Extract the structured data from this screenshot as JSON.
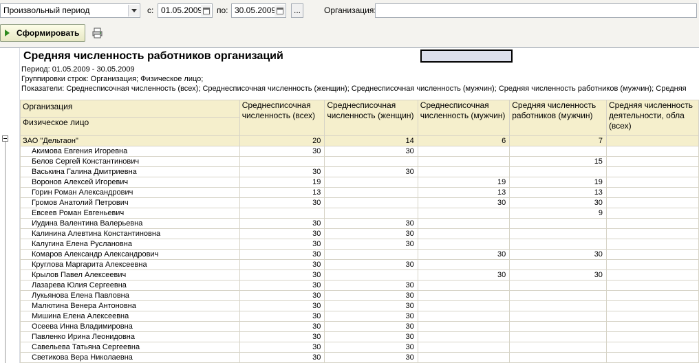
{
  "toolbar": {
    "period_type": "Произвольный период",
    "from_label": "с:",
    "from_date": "01.05.2009",
    "to_label": "по:",
    "to_date": "30.05.2009",
    "more_label": "...",
    "org_label": "Организация:",
    "org_value": "",
    "generate_label": "Сформировать"
  },
  "report": {
    "title": "Средняя численность работников организаций",
    "period": "Период: 01.05.2009 - 30.05.2009",
    "grouping": "Группировки строк: Организация; Физическое лицо;",
    "indicators": "Показатели: Среднесписочная численность (всех); Среднесписочная численность (женщин); Среднесписочная численность (мужчин); Средняя численность работников (мужчин); Средняя",
    "header_org": "Организация",
    "header_person": "Физическое лицо",
    "col1": "Среднесписочная численность (всех)",
    "col2": "Среднесписочная численность (женщин)",
    "col3": "Среднесписочная численность (мужчин)",
    "col4": "Средняя численность работников (мужчин)",
    "col5": "Средняя численность деятельности, обла (всех)",
    "group": {
      "name": "ЗАО \"Дельтаон\"",
      "c1": "20",
      "c2": "14",
      "c3": "6",
      "c4": "7"
    },
    "rows": [
      {
        "name": "Акимова Евгения Игоревна",
        "c1": "30",
        "c2": "30",
        "c3": "",
        "c4": ""
      },
      {
        "name": "Белов Сергей Константинович",
        "c1": "",
        "c2": "",
        "c3": "",
        "c4": "15"
      },
      {
        "name": "Васькина Галина Дмитриевна",
        "c1": "30",
        "c2": "30",
        "c3": "",
        "c4": ""
      },
      {
        "name": "Воронов Алексей Игоревич",
        "c1": "19",
        "c2": "",
        "c3": "19",
        "c4": "19"
      },
      {
        "name": "Горин Роман Александрович",
        "c1": "13",
        "c2": "",
        "c3": "13",
        "c4": "13"
      },
      {
        "name": "Громов Анатолий Петрович",
        "c1": "30",
        "c2": "",
        "c3": "30",
        "c4": "30"
      },
      {
        "name": "Евсеев Роман Евгеньевич",
        "c1": "",
        "c2": "",
        "c3": "",
        "c4": "9"
      },
      {
        "name": "Иудина Валентина Валерьевна",
        "c1": "30",
        "c2": "30",
        "c3": "",
        "c4": ""
      },
      {
        "name": "Калинина Алевтина Константиновна",
        "c1": "30",
        "c2": "30",
        "c3": "",
        "c4": ""
      },
      {
        "name": "Калугина Елена Руслановна",
        "c1": "30",
        "c2": "30",
        "c3": "",
        "c4": ""
      },
      {
        "name": "Комаров Александр Александрович",
        "c1": "30",
        "c2": "",
        "c3": "30",
        "c4": "30"
      },
      {
        "name": "Круглова Маргарита Алексеевна",
        "c1": "30",
        "c2": "30",
        "c3": "",
        "c4": ""
      },
      {
        "name": "Крылов Павел Алексеевич",
        "c1": "30",
        "c2": "",
        "c3": "30",
        "c4": "30"
      },
      {
        "name": "Лазарева Юлия Сергеевна",
        "c1": "30",
        "c2": "30",
        "c3": "",
        "c4": ""
      },
      {
        "name": "Лукьянова Елена Павловна",
        "c1": "30",
        "c2": "30",
        "c3": "",
        "c4": ""
      },
      {
        "name": "Малютина Венера Антоновна",
        "c1": "30",
        "c2": "30",
        "c3": "",
        "c4": ""
      },
      {
        "name": "Мишина Елена Алексеевна",
        "c1": "30",
        "c2": "30",
        "c3": "",
        "c4": ""
      },
      {
        "name": "Осеева Инна Владимировна",
        "c1": "30",
        "c2": "30",
        "c3": "",
        "c4": ""
      },
      {
        "name": "Павленко Ирина Леонидовна",
        "c1": "30",
        "c2": "30",
        "c3": "",
        "c4": ""
      },
      {
        "name": "Савельева Татьяна Сергеевна",
        "c1": "30",
        "c2": "30",
        "c3": "",
        "c4": ""
      },
      {
        "name": "Светикова Вера Николаевна",
        "c1": "30",
        "c2": "30",
        "c3": "",
        "c4": ""
      }
    ]
  }
}
